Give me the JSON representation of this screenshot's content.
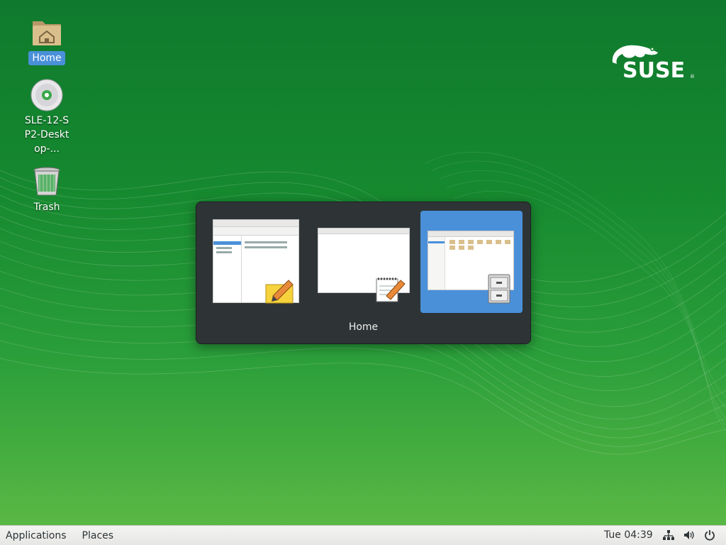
{
  "desktop": {
    "icons": [
      {
        "label": "Home",
        "icon": "home-folder-icon",
        "selected": true
      },
      {
        "label": "SLE-12-SP2-Desktop-...",
        "icon": "optical-disc-icon",
        "selected": false
      },
      {
        "label": "Trash",
        "icon": "trash-icon",
        "selected": false
      }
    ],
    "logo_text": "SUSE",
    "logo_mark": "®"
  },
  "switcher": {
    "title": "Home",
    "windows": [
      {
        "app": "notes-app",
        "icon": "notes-pencil-icon",
        "selected": false
      },
      {
        "app": "text-editor-app",
        "icon": "notepad-pencil-icon",
        "selected": false
      },
      {
        "app": "files-app",
        "icon": "file-cabinet-icon",
        "selected": true
      }
    ]
  },
  "panel": {
    "applications_label": "Applications",
    "places_label": "Places",
    "clock": "Tue 04:39",
    "tray": [
      "network-icon",
      "volume-icon",
      "power-icon"
    ]
  },
  "colors": {
    "accent": "#4a90d9",
    "switcher_bg": "#2e3436",
    "wallpaper_top": "#0f7a2e",
    "wallpaper_bottom": "#5fbb45"
  }
}
